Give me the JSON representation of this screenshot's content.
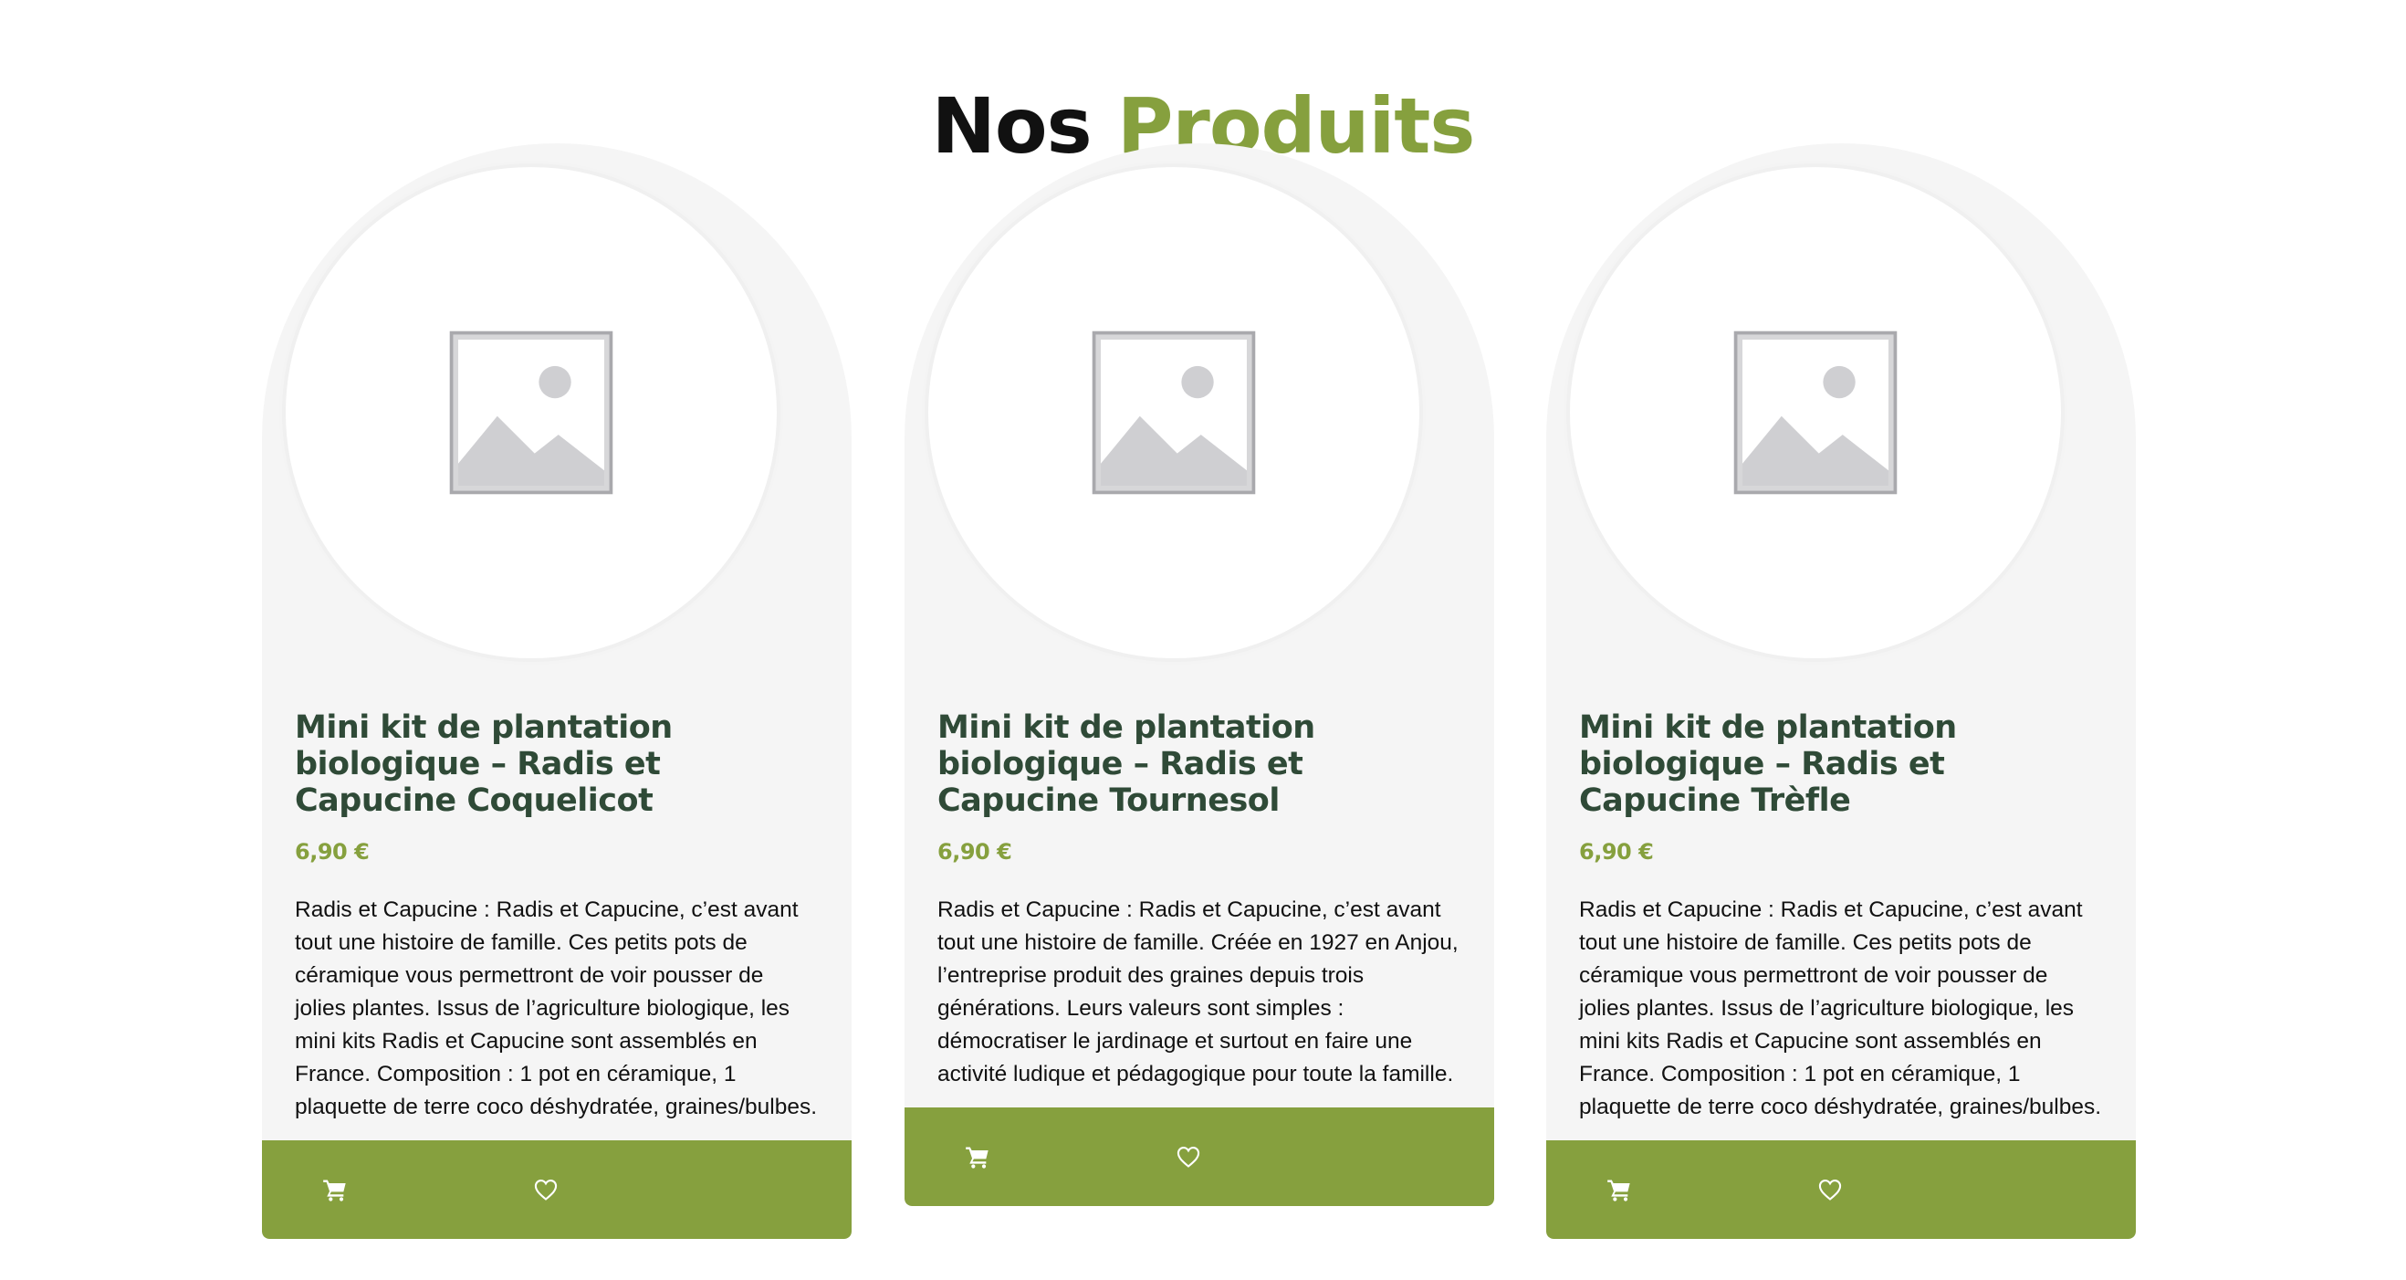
{
  "section": {
    "title_main": "Nos",
    "title_accent": "Produits",
    "accent_color": "#86a03e"
  },
  "products": [
    {
      "title": "Mini kit de plantation biologique – Radis et Capucine Coquelicot",
      "price": "6,90 €",
      "description": "Radis et Capucine : Radis et Capucine, c’est avant tout une histoire de famille. Ces petits pots de céramique vous permettront de voir pousser de jolies plantes. Issus de l’agriculture biologique, les mini kits Radis et Capucine sont assemblés en France. Composition : 1 pot en céramique, 1 plaquette de terre coco déshydratée, graines/bulbes.",
      "image_icon": "image-placeholder-icon",
      "cart_icon": "cart-icon",
      "wishlist_icon": "heart-icon"
    },
    {
      "title": "Mini kit de plantation biologique – Radis et Capucine Tournesol",
      "price": "6,90 €",
      "description": "Radis et Capucine : Radis et Capucine, c’est avant tout une histoire de famille. Créée en 1927 en Anjou, l’entreprise produit des graines depuis trois générations. Leurs valeurs sont simples : démocratiser le jardinage et surtout en faire une activité ludique et pédagogique pour toute la famille.",
      "image_icon": "image-placeholder-icon",
      "cart_icon": "cart-icon",
      "wishlist_icon": "heart-icon"
    },
    {
      "title": "Mini kit de plantation biologique – Radis et Capucine Trèfle",
      "price": "6,90 €",
      "description": "Radis et Capucine : Radis et Capucine, c’est avant tout une histoire de famille. Ces petits pots de céramique vous permettront de voir pousser de jolies plantes. Issus de l’agriculture biologique, les mini kits Radis et Capucine sont assemblés en France. Composition : 1 pot en céramique, 1 plaquette de terre coco déshydratée, graines/bulbes.",
      "image_icon": "image-placeholder-icon",
      "cart_icon": "cart-icon",
      "wishlist_icon": "heart-icon"
    }
  ]
}
